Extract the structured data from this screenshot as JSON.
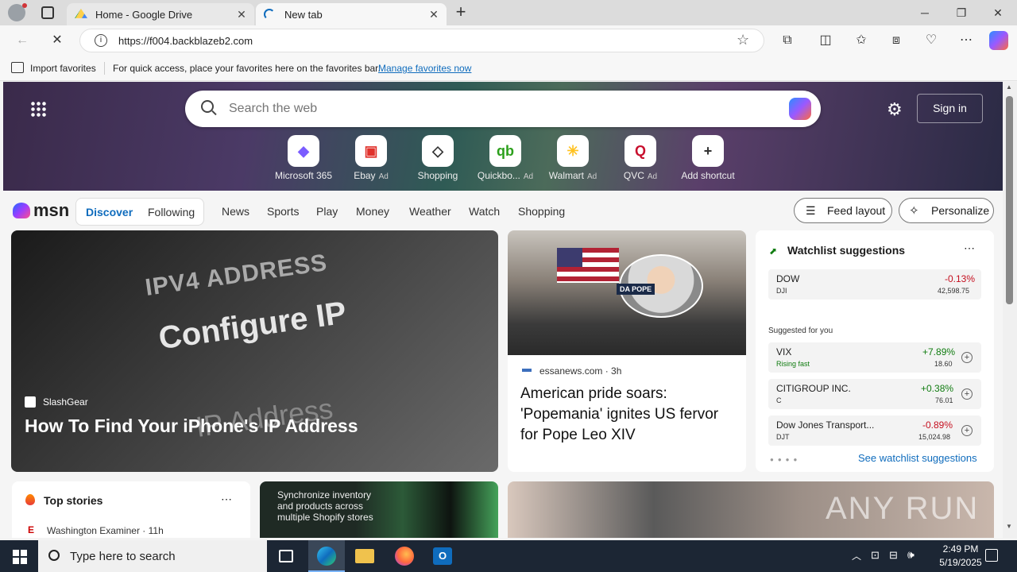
{
  "browser": {
    "tabs": [
      {
        "title": "Home - Google Drive",
        "icon": "google-drive-icon"
      },
      {
        "title": "New tab",
        "icon": "loading-spinner-icon"
      }
    ],
    "url": "https://f004.backblazeb2.com",
    "favbar": {
      "import_label": "Import favorites",
      "hint": "For quick access, place your favorites here on the favorites bar.",
      "manage_link": "Manage favorites now"
    }
  },
  "newtab": {
    "search_placeholder": "Search the web",
    "sign_in": "Sign in",
    "shortcuts": [
      {
        "label": "Microsoft 365",
        "ad": "",
        "glyph": "◆",
        "color": "#7a5cff"
      },
      {
        "label": "Ebay",
        "ad": "Ad",
        "glyph": "▣",
        "color": "#e0312b"
      },
      {
        "label": "Shopping",
        "ad": "",
        "glyph": "◇",
        "color": "#333333"
      },
      {
        "label": "Quickbo...",
        "ad": "Ad",
        "glyph": "qb",
        "color": "#2ca01c"
      },
      {
        "label": "Walmart",
        "ad": "Ad",
        "glyph": "✳",
        "color": "#ffc220"
      },
      {
        "label": "QVC",
        "ad": "Ad",
        "glyph": "Q",
        "color": "#c8102e"
      },
      {
        "label": "Add shortcut",
        "ad": "",
        "glyph": "+",
        "color": "#333333"
      }
    ]
  },
  "msn": {
    "logo": "msn",
    "tabs": [
      "Discover",
      "Following"
    ],
    "nav": [
      "News",
      "Sports",
      "Play",
      "Money",
      "Weather",
      "Watch",
      "Shopping"
    ],
    "feed_layout": "Feed layout",
    "personalize": "Personalize",
    "big_card": {
      "source": "SlashGear",
      "headline": "How To Find Your iPhone's IP Address",
      "image_text_1": "IPV4 ADDRESS",
      "image_text_2": "Configure IP",
      "image_text_3": "IP Address"
    },
    "mid_card": {
      "source": "essanews.com",
      "age": "3h",
      "headline": "American pride soars: 'Popemania' ignites US fervor for Pope Leo XIV",
      "shirt_text": "DA POPE"
    },
    "watchlist": {
      "title": "Watchlist suggestions",
      "top": {
        "name": "DOW",
        "sub": "DJI",
        "change": "-0.13%",
        "value": "42,598.75"
      },
      "suggested_label": "Suggested for you",
      "items": [
        {
          "name": "VIX",
          "sub": "Rising fast",
          "change": "+7.89%",
          "value": "18.60"
        },
        {
          "name": "CITIGROUP INC.",
          "sub": "C",
          "change": "+0.38%",
          "value": "76.01"
        },
        {
          "name": "Dow Jones Transport...",
          "sub": "DJT",
          "change": "-0.89%",
          "value": "15,024.98"
        }
      ],
      "see_more": "See watchlist suggestions"
    },
    "top_stories": {
      "title": "Top stories",
      "first_source": "Washington Examiner",
      "first_age": "11h"
    },
    "ad_card": {
      "text": "Synchronize inventory and products across multiple Shopify stores"
    },
    "watermark": "ANY RUN"
  },
  "taskbar": {
    "search_placeholder": "Type here to search",
    "time": "2:49 PM",
    "date": "5/19/2025"
  },
  "colors": {
    "accent": "#0f6cbd",
    "positive": "#107c10",
    "negative": "#c50f1f"
  }
}
